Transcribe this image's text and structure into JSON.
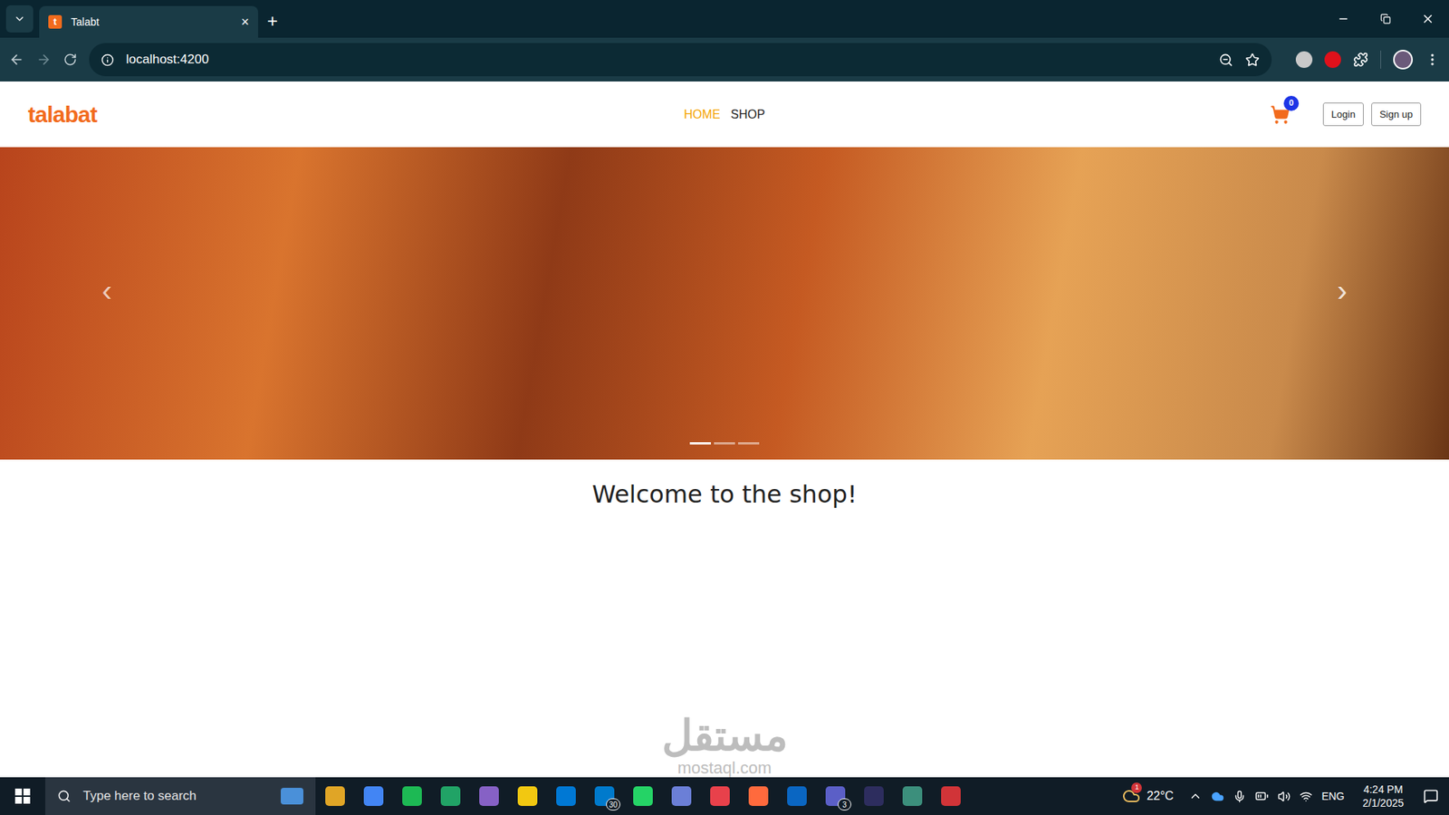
{
  "browser": {
    "tab": {
      "favicon": "t",
      "title": "Talabt"
    },
    "new_tab": "+",
    "close_tab": "×",
    "address": "localhost:4200"
  },
  "page": {
    "logo": "talabat",
    "nav": [
      {
        "label": "HOME",
        "selected": true
      },
      {
        "label": "SHOP",
        "selected": false
      }
    ],
    "cart": {
      "count": "0"
    },
    "buttons": [
      "Login",
      "Sign up"
    ],
    "carousel": {
      "prev": "‹",
      "next": "›",
      "indicators": [
        {
          "selected": true
        },
        {
          "selected": false
        },
        {
          "selected": false
        }
      ]
    },
    "welcome": "Welcome to the shop!"
  },
  "watermark": {
    "arabic": "مستقل",
    "latin": "mostaql.com"
  },
  "taskbar": {
    "search": {
      "placeholder": "Type here to search"
    },
    "apps": [
      {
        "badge": ""
      },
      {
        "badge": ""
      },
      {
        "badge": ""
      },
      {
        "badge": ""
      },
      {
        "badge": ""
      },
      {
        "badge": ""
      },
      {
        "badge": ""
      },
      {
        "badge": "30"
      },
      {
        "badge": ""
      },
      {
        "badge": ""
      },
      {
        "badge": ""
      },
      {
        "badge": ""
      },
      {
        "badge": ""
      },
      {
        "badge": "3"
      },
      {
        "badge": ""
      },
      {
        "badge": ""
      },
      {
        "badge": ""
      }
    ],
    "weather": {
      "badge": "1",
      "temp": "22°C"
    },
    "language": "ENG",
    "time": "4:24 PM",
    "date": "2/1/2025"
  }
}
